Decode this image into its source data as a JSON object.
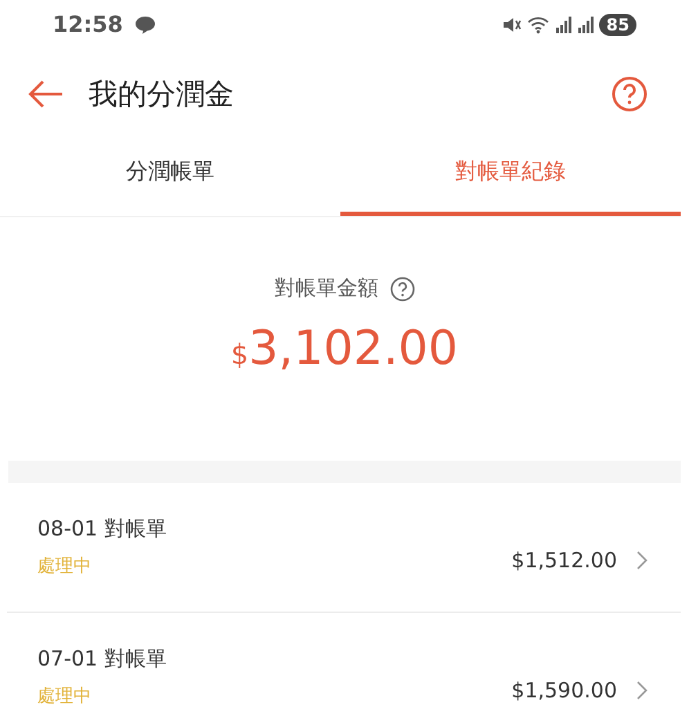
{
  "status_bar": {
    "time": "12:58",
    "battery": "85"
  },
  "header": {
    "title": "我的分潤金"
  },
  "tabs": [
    {
      "label": "分潤帳單",
      "selected": false
    },
    {
      "label": "對帳單紀錄",
      "selected": true
    }
  ],
  "summary": {
    "label": "對帳單金額",
    "currency": "$",
    "amount": "3,102.00"
  },
  "statements": [
    {
      "title": "08-01 對帳單",
      "status": "處理中",
      "amount": "$1,512.00"
    },
    {
      "title": "07-01 對帳單",
      "status": "處理中",
      "amount": "$1,590.00"
    }
  ]
}
